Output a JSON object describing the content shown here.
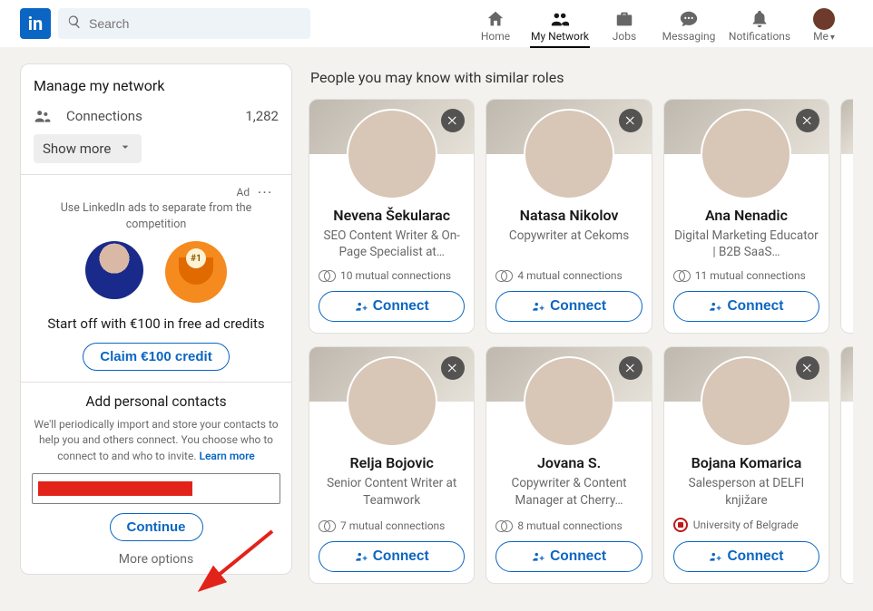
{
  "nav": {
    "search_placeholder": "Search",
    "items": {
      "home": "Home",
      "network": "My Network",
      "jobs": "Jobs",
      "messaging": "Messaging",
      "notifications": "Notifications",
      "me": "Me"
    }
  },
  "sidebar": {
    "manage_title": "Manage my network",
    "connections_label": "Connections",
    "connections_count": "1,282",
    "show_more": "Show more",
    "ad": {
      "tag": "Ad",
      "line": "Use LinkedIn ads to separate from the competition",
      "trophy_badge": "#1",
      "headline": "Start off with €100 in free ad credits",
      "cta": "Claim €100 credit"
    },
    "contacts": {
      "title": "Add personal contacts",
      "desc_a": "We'll periodically import and store your contacts to help you and others connect. You choose who to connect to and who to invite. ",
      "learn_more": "Learn more",
      "continue": "Continue",
      "more_options": "More options"
    }
  },
  "main": {
    "section_title": "People you may know with similar roles",
    "connect_label": "Connect",
    "people_row1": [
      {
        "name": "Nevena Šekularac",
        "subtitle": "SEO Content Writer & On-Page Specialist at…",
        "mutual": "10 mutual connections"
      },
      {
        "name": "Natasa Nikolov",
        "subtitle": "Copywriter at Cekoms",
        "mutual": "4 mutual connections"
      },
      {
        "name": "Ana Nenadic",
        "subtitle": "Digital Marketing Educator | B2B SaaS…",
        "mutual": "11 mutual connections"
      }
    ],
    "people_row2": [
      {
        "name": "Relja Bojovic",
        "subtitle": "Senior Content Writer at Teamwork",
        "mutual": "7 mutual connections"
      },
      {
        "name": "Jovana S.",
        "subtitle": "Copywriter & Content Manager at Cherry…",
        "mutual": "8 mutual connections"
      },
      {
        "name": "Bojana Komarica",
        "subtitle": "Salesperson at DELFI knjižare",
        "mutual": "University of Belgrade",
        "uni": true
      }
    ]
  }
}
